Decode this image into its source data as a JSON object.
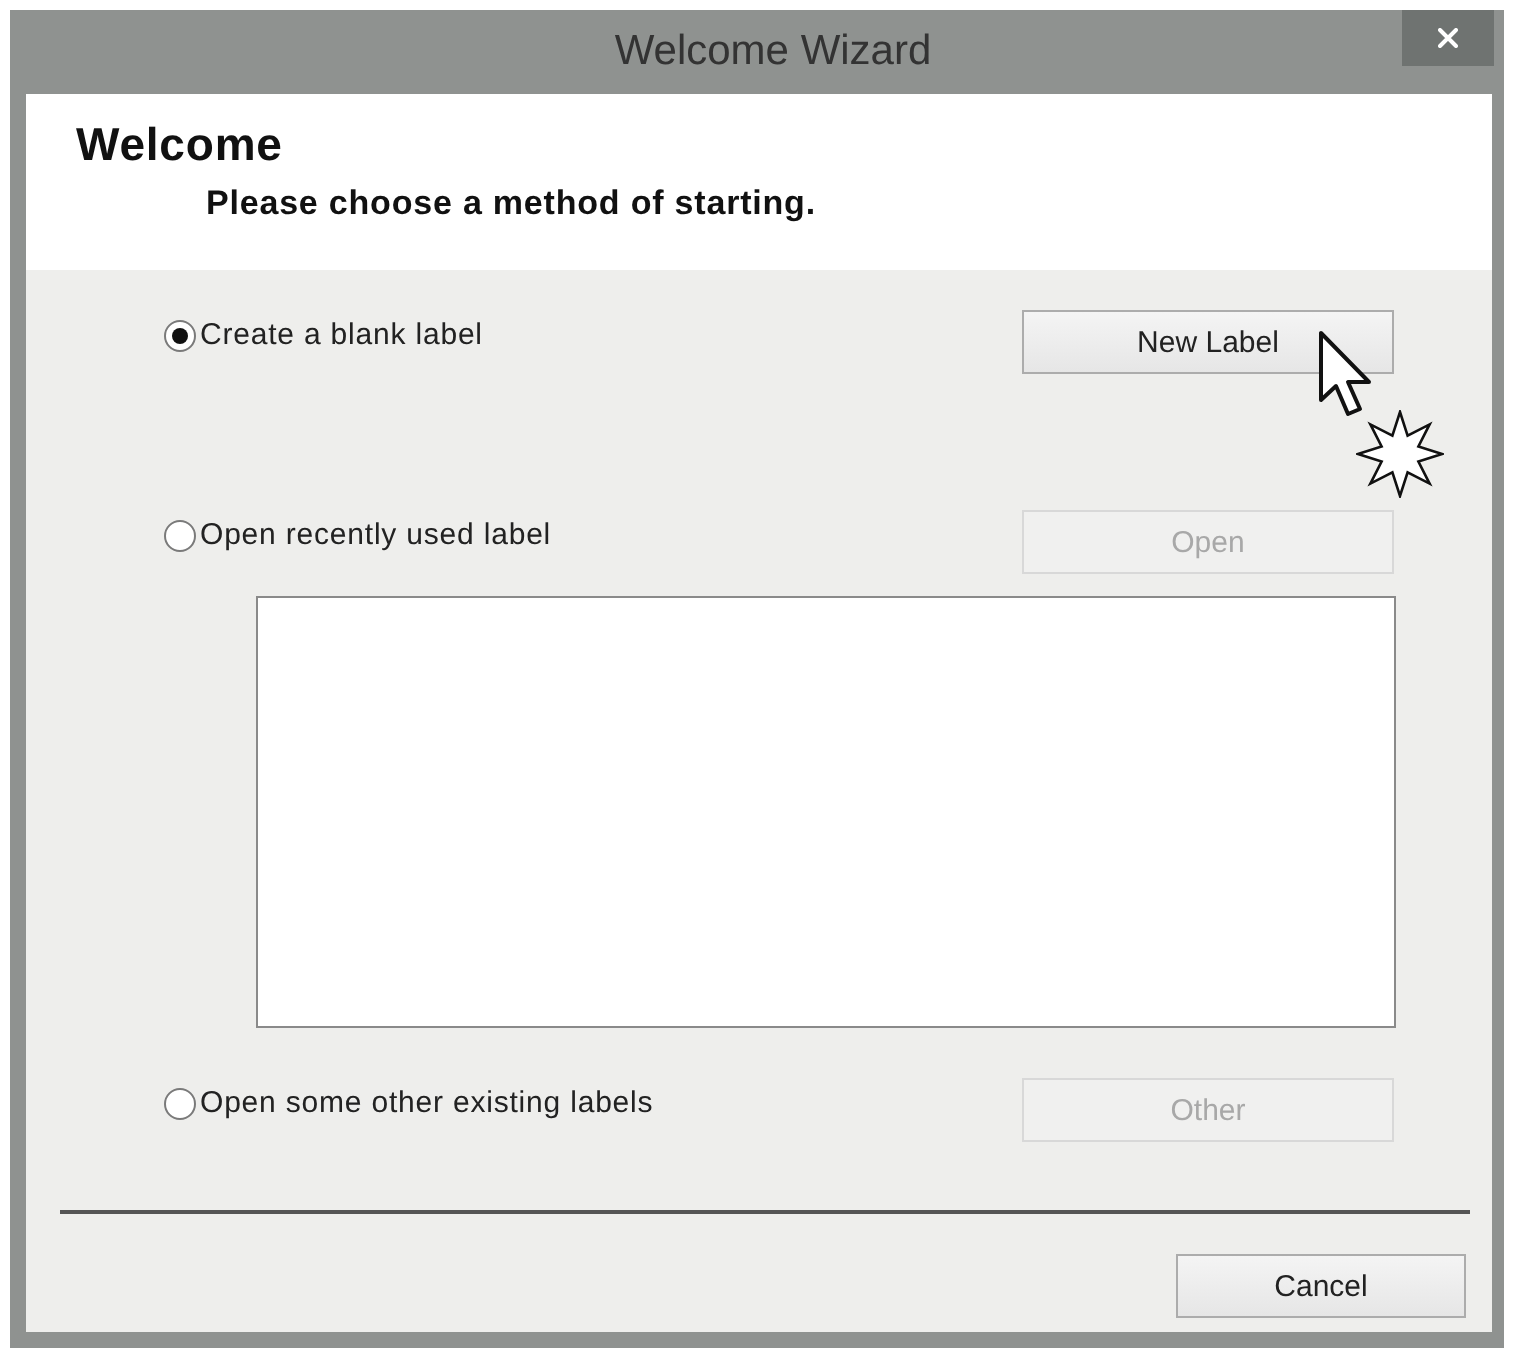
{
  "window": {
    "title": "Welcome Wizard"
  },
  "header": {
    "title": "Welcome",
    "subtitle": "Please choose a method of starting."
  },
  "options": [
    {
      "label": "Create a blank label",
      "selected": true,
      "kind": "plain",
      "button": {
        "label": "New Label",
        "disabled": false,
        "pointer": true
      }
    },
    {
      "label": "Open recently used label",
      "selected": false,
      "kind": "with-list",
      "button": {
        "label": "Open",
        "disabled": true,
        "pointer": false
      }
    },
    {
      "label": "Open some other existing labels",
      "selected": false,
      "kind": "plain",
      "button": {
        "label": "Other",
        "disabled": true,
        "pointer": false
      }
    }
  ],
  "footer": {
    "buttons": [
      "Cancel"
    ]
  }
}
